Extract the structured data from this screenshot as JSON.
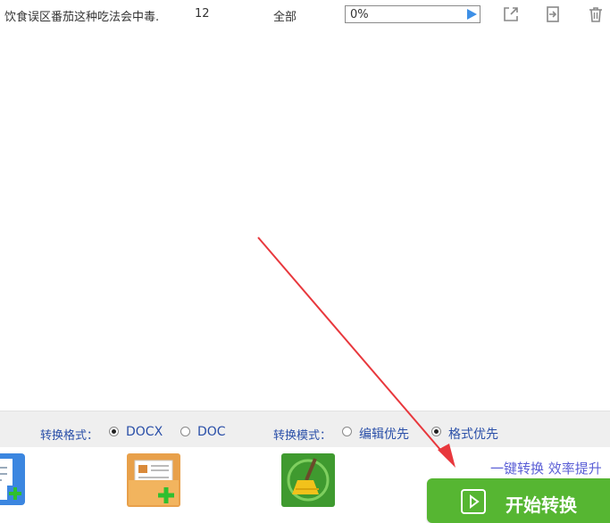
{
  "file_row": {
    "name": "饮食误区番茄这种吃法会中毒.",
    "pages": "12",
    "range": "全部",
    "progress": "0%",
    "progress_fraction": 0,
    "actions": [
      "open-external-icon",
      "export-icon",
      "trash-icon"
    ]
  },
  "options": {
    "format_label": "转换格式：",
    "format_options": [
      "DOCX",
      "DOC"
    ],
    "format_selected": "DOCX",
    "mode_label": "转换模式：",
    "mode_options": [
      "编辑优先",
      "格式优先"
    ],
    "mode_selected": "格式优先"
  },
  "tools": [
    "add-file-icon",
    "add-folder-icon",
    "clear-list-icon"
  ],
  "slogan": "一键转换  效率提升",
  "start_button": {
    "label": "开始转换"
  },
  "colors": {
    "accent_green": "#56b632",
    "link_blue": "#2a4fa8",
    "slogan_purple": "#5b5fd6",
    "annotation_red": "#e8383d"
  }
}
